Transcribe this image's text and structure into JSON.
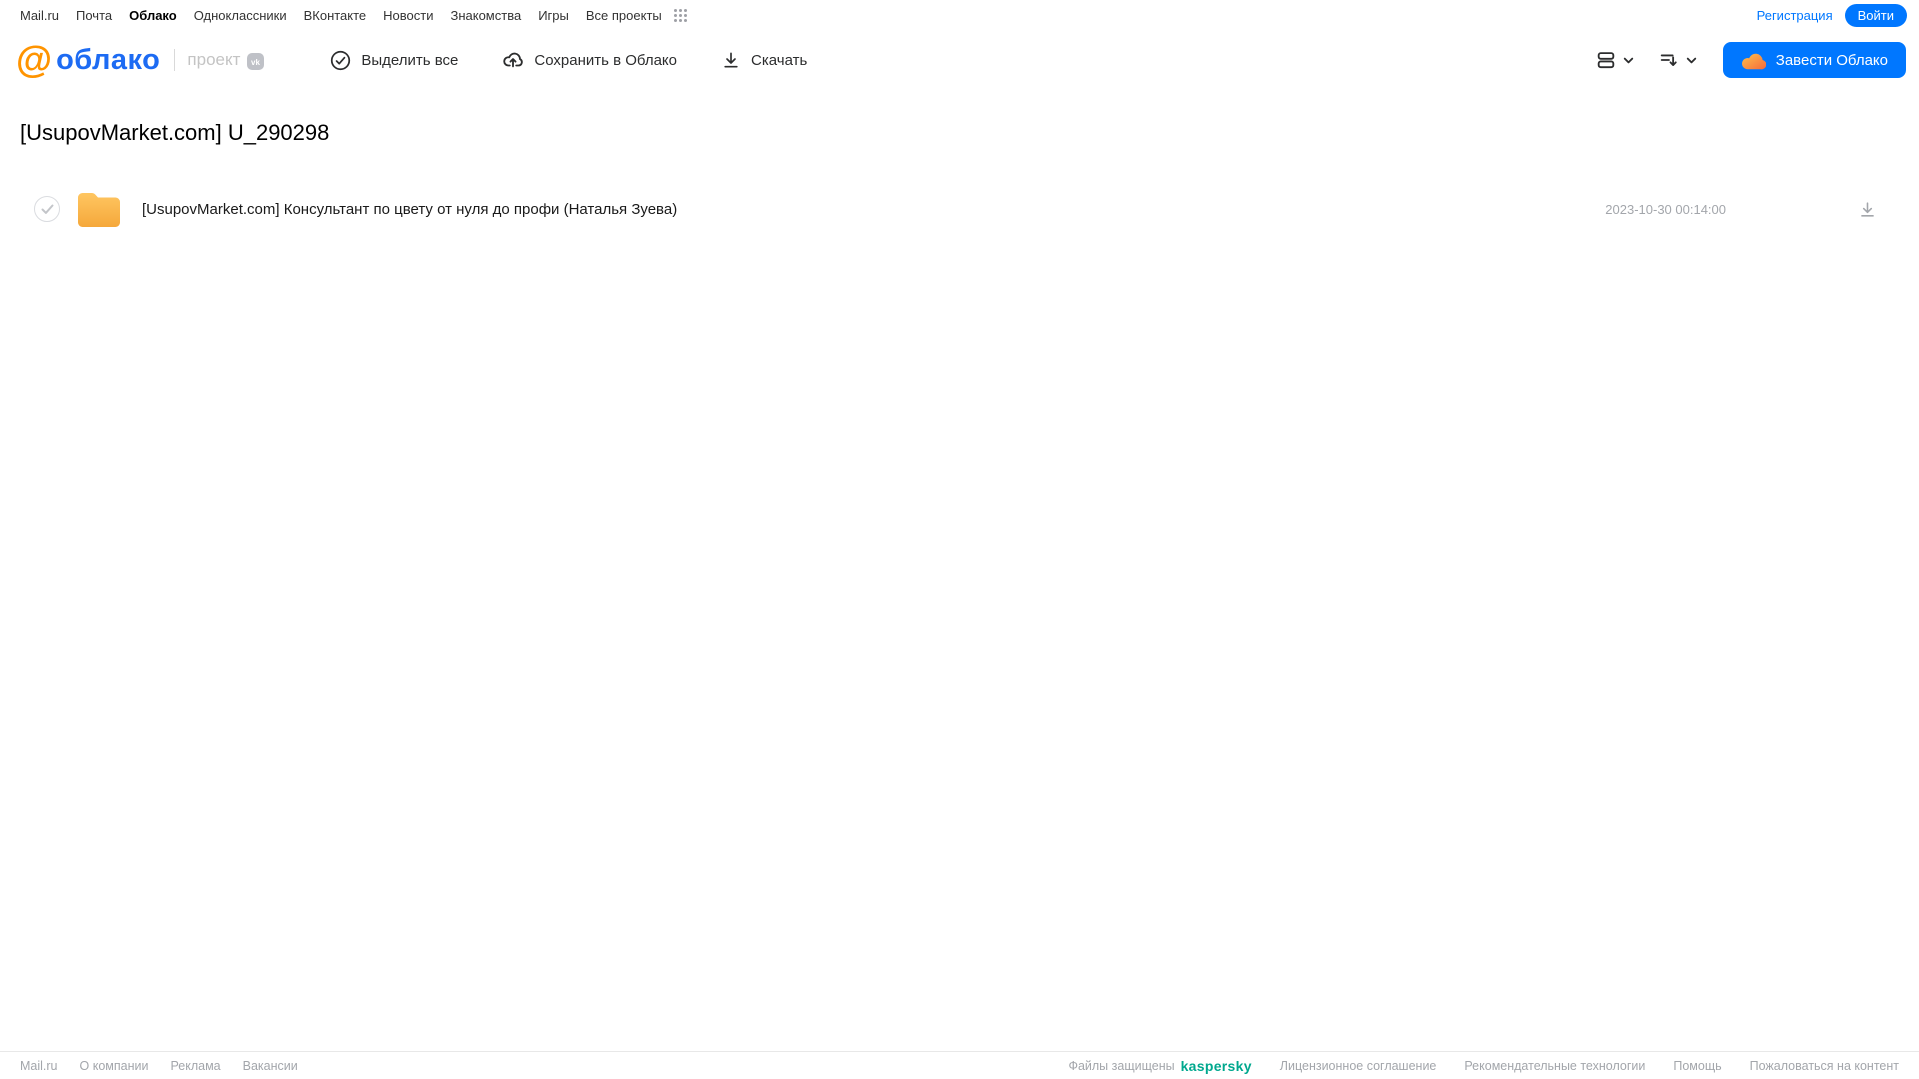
{
  "topnav": {
    "links": [
      {
        "label": "Mail.ru"
      },
      {
        "label": "Почта"
      },
      {
        "label": "Облако"
      },
      {
        "label": "Одноклассники"
      },
      {
        "label": "ВКонтакте"
      },
      {
        "label": "Новости"
      },
      {
        "label": "Знакомства"
      },
      {
        "label": "Игры"
      },
      {
        "label": "Все проекты"
      }
    ],
    "registration_label": "Регистрация",
    "login_label": "Войти"
  },
  "header": {
    "logo_at": "@",
    "logo_text": "облако",
    "project_label": "проект",
    "vk_badge_label": "vk",
    "toolbar": {
      "select_all_label": "Выделить все",
      "save_to_cloud_label": "Сохранить в Облако",
      "download_label": "Скачать"
    },
    "create_cloud_label": "Завести Облако"
  },
  "main": {
    "title": "[UsupovMarket.com] U_290298",
    "files": [
      {
        "name": "[UsupovMarket.com] Консультант по цвету от нуля до профи (Наталья Зуева)",
        "date": "2023-10-30 00:14:00"
      }
    ]
  },
  "footer": {
    "left_links": [
      "Mail.ru",
      "О компании",
      "Реклама",
      "Вакансии"
    ],
    "protected_label": "Файлы защищены",
    "kaspersky_label": "kaspersky",
    "right_links": [
      "Лицензионное соглашение",
      "Рекомендательные технологии",
      "Помощь",
      "Пожаловаться на контент"
    ]
  },
  "colors": {
    "accent_blue": "#0077ff",
    "logo_orange": "#ff9400",
    "kaspersky_green": "#00a88e",
    "folder_top": "#ffc661",
    "folder_bottom": "#f5a83b"
  }
}
